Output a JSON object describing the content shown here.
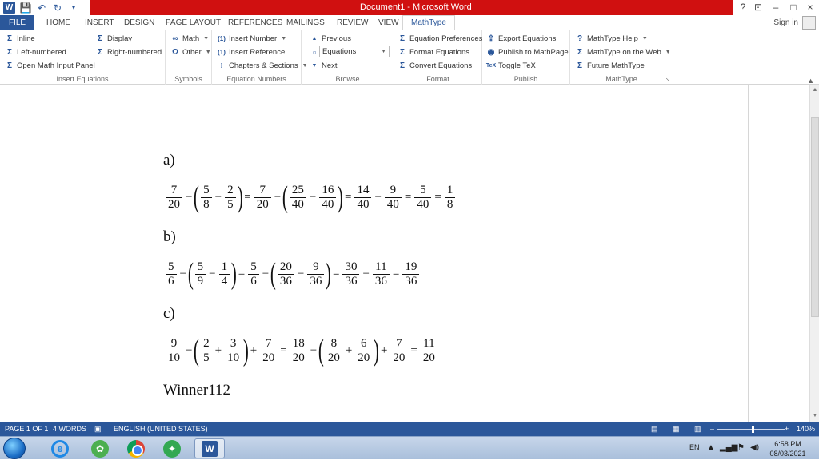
{
  "titlebar": {
    "title": "Document1 - Microsoft Word",
    "help": "?",
    "minimize": "–",
    "restore": "□",
    "close": "×"
  },
  "tabs": {
    "file": "FILE",
    "items": [
      "HOME",
      "INSERT",
      "DESIGN",
      "PAGE LAYOUT",
      "REFERENCES",
      "MAILINGS",
      "REVIEW",
      "VIEW"
    ],
    "active": "MathType",
    "sign_in": "Sign in"
  },
  "ribbon": {
    "insert_equations": {
      "label": "Insert Equations",
      "inline": "Inline",
      "left_numbered": "Left-numbered",
      "open_math": "Open Math Input Panel",
      "display": "Display",
      "right_numbered": "Right-numbered"
    },
    "symbols": {
      "label": "Symbols",
      "math": "Math",
      "other": "Other"
    },
    "equation_numbers": {
      "label": "Equation Numbers",
      "insert_number": "Insert Number",
      "insert_reference": "Insert Reference",
      "chapters": "Chapters & Sections"
    },
    "browse": {
      "label": "Browse",
      "previous": "Previous",
      "select_value": "Equations",
      "next": "Next"
    },
    "format": {
      "label": "Format",
      "preferences": "Equation Preferences",
      "format_equations": "Format Equations",
      "convert": "Convert Equations"
    },
    "publish": {
      "label": "Publish",
      "export": "Export Equations",
      "publish_mathpage": "Publish to MathPage",
      "toggle_tex": "Toggle TeX"
    },
    "mathtype": {
      "label": "MathType",
      "help": "MathType Help",
      "on_web": "MathType on the Web",
      "future": "Future MathType"
    }
  },
  "document": {
    "label_a": "a)",
    "label_b": "b)",
    "label_c": "c)",
    "eq_a": {
      "f1": [
        "7",
        "20"
      ],
      "f2": [
        "5",
        "8"
      ],
      "f3": [
        "2",
        "5"
      ],
      "f4": [
        "7",
        "20"
      ],
      "f5": [
        "25",
        "40"
      ],
      "f6": [
        "16",
        "40"
      ],
      "f7": [
        "14",
        "40"
      ],
      "f8": [
        "9",
        "40"
      ],
      "f9": [
        "5",
        "40"
      ],
      "f10": [
        "1",
        "8"
      ]
    },
    "eq_b": {
      "f1": [
        "5",
        "6"
      ],
      "f2": [
        "5",
        "9"
      ],
      "f3": [
        "1",
        "4"
      ],
      "f4": [
        "5",
        "6"
      ],
      "f5": [
        "20",
        "36"
      ],
      "f6": [
        "9",
        "36"
      ],
      "f7": [
        "30",
        "36"
      ],
      "f8": [
        "11",
        "36"
      ],
      "f9": [
        "19",
        "36"
      ]
    },
    "eq_c": {
      "f1": [
        "9",
        "10"
      ],
      "f2": [
        "2",
        "5"
      ],
      "f3": [
        "3",
        "10"
      ],
      "f4": [
        "7",
        "20"
      ],
      "f5": [
        "18",
        "20"
      ],
      "f6": [
        "8",
        "20"
      ],
      "f7": [
        "6",
        "20"
      ],
      "f8": [
        "7",
        "20"
      ],
      "f9": [
        "11",
        "20"
      ]
    },
    "signature": "Winner112"
  },
  "statusbar": {
    "page": "PAGE 1 OF 1",
    "words": "4 WORDS",
    "language": "ENGLISH (UNITED STATES)",
    "zoom": "140%",
    "zoom_minus": "–",
    "zoom_plus": "+"
  },
  "taskbar": {
    "lang": "EN",
    "time": "6:58 PM",
    "date": "08/03/2021"
  }
}
